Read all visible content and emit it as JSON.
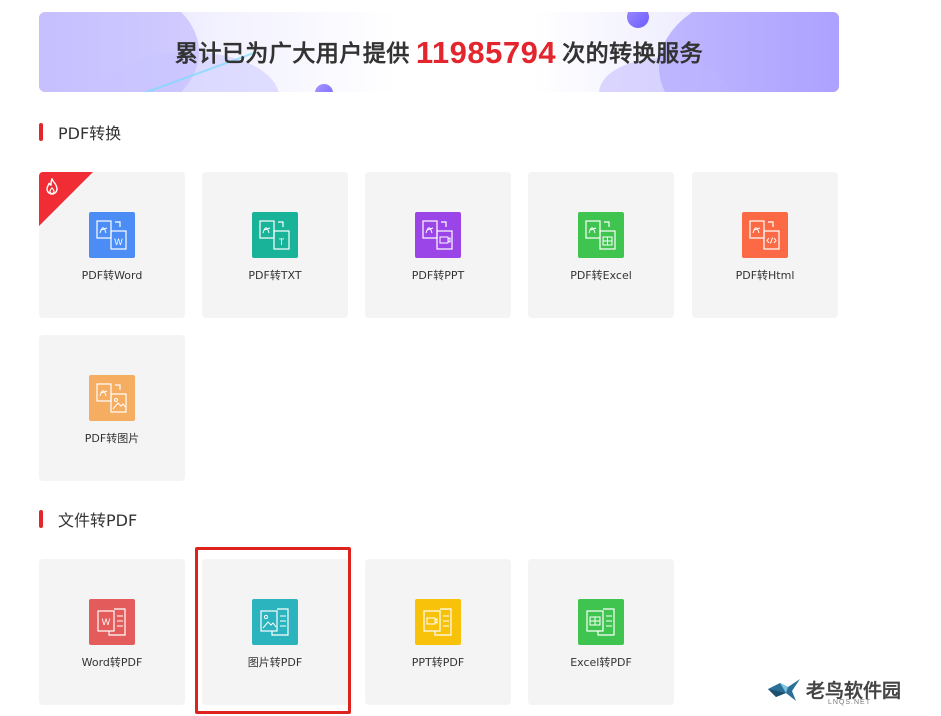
{
  "banner": {
    "prefix": "累计已为广大用户提供",
    "count": "11985794",
    "suffix": "次的转换服务",
    "pages": 4,
    "active_page": 1
  },
  "sections": [
    {
      "title": "PDF转换",
      "items": [
        {
          "label": "PDF转Word",
          "color": "#4b8cf5",
          "icon": "pdf-to-word-icon",
          "hot": true
        },
        {
          "label": "PDF转TXT",
          "color": "#19b39a",
          "icon": "pdf-to-txt-icon"
        },
        {
          "label": "PDF转PPT",
          "color": "#9b45e8",
          "icon": "pdf-to-ppt-icon"
        },
        {
          "label": "PDF转Excel",
          "color": "#3fc44f",
          "icon": "pdf-to-excel-icon"
        },
        {
          "label": "PDF转Html",
          "color": "#fb6a45",
          "icon": "pdf-to-html-icon"
        },
        {
          "label": "PDF转图片",
          "color": "#f5ad62",
          "icon": "pdf-to-image-icon"
        }
      ]
    },
    {
      "title": "文件转PDF",
      "items": [
        {
          "label": "Word转PDF",
          "color": "#e45b5b",
          "icon": "word-to-pdf-icon"
        },
        {
          "label": "图片转PDF",
          "color": "#2bb3be",
          "icon": "image-to-pdf-icon",
          "selected": true
        },
        {
          "label": "PPT转PDF",
          "color": "#f9c20a",
          "icon": "ppt-to-pdf-icon"
        },
        {
          "label": "Excel转PDF",
          "color": "#3fc44f",
          "icon": "excel-to-pdf-icon"
        }
      ]
    }
  ],
  "watermark": {
    "text": "老鸟软件园",
    "sub": "LNQS.NET"
  },
  "colors": {
    "accent": "#e3262d",
    "tile_bg": "#f4f4f4"
  }
}
